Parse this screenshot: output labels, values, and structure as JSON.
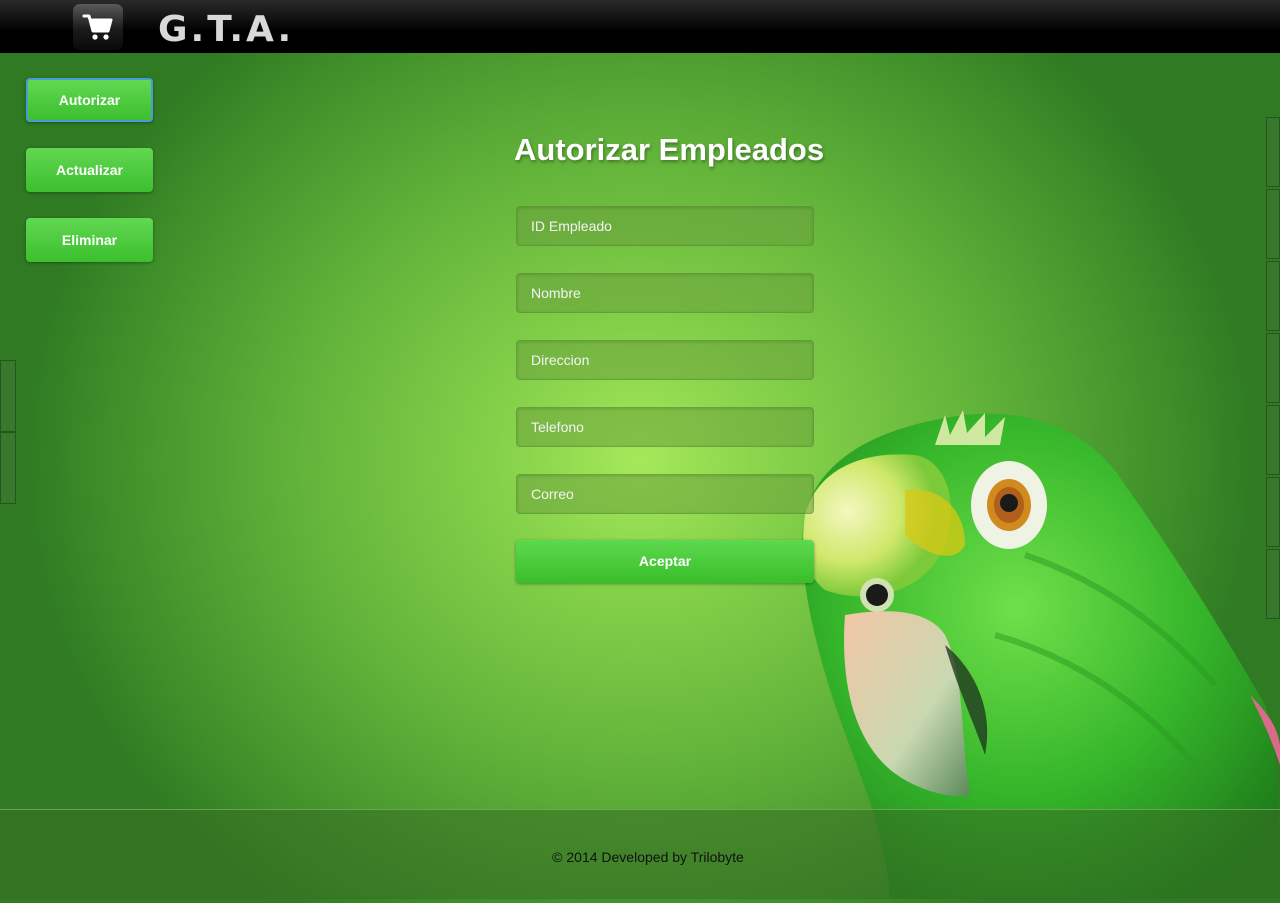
{
  "header": {
    "brand": "G.T.A.",
    "cart_icon": "shopping-cart-icon"
  },
  "sidebar": {
    "items": [
      {
        "label": "Autorizar",
        "active": true
      },
      {
        "label": "Actualizar",
        "active": false
      },
      {
        "label": "Eliminar",
        "active": false
      }
    ]
  },
  "form": {
    "title": "Autorizar Empleados",
    "fields": [
      {
        "placeholder": "ID Empleado"
      },
      {
        "placeholder": "Nombre"
      },
      {
        "placeholder": "Direccion"
      },
      {
        "placeholder": "Telefono"
      },
      {
        "placeholder": "Correo"
      }
    ],
    "submit_label": "Aceptar"
  },
  "footer": {
    "text": "© 2014 Developed by Trilobyte"
  },
  "colors": {
    "accent_button": "#3cbf2e",
    "topbar": "#000000",
    "background": "#86d24a"
  }
}
